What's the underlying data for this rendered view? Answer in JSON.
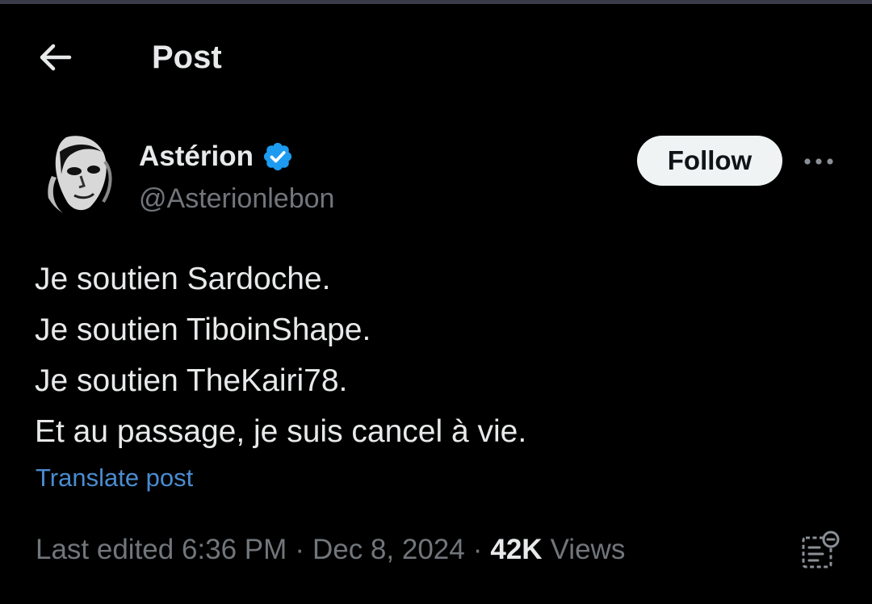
{
  "header": {
    "back_icon": "arrow-left-icon",
    "title": "Post"
  },
  "author": {
    "display_name": "Astérion",
    "handle": "@Asterionlebon",
    "verified_icon": "verified-badge-icon",
    "verified_color": "#1d9bf0"
  },
  "actions": {
    "follow_label": "Follow",
    "more_icon": "more-options-icon"
  },
  "post": {
    "lines": [
      "Je soutien Sardoche.",
      "Je soutien TiboinShape.",
      "Je soutien TheKairi78.",
      "Et au passage, je suis cancel à vie."
    ],
    "translate_label": "Translate post"
  },
  "meta": {
    "edited_time": "Last edited 6:36 PM",
    "separator": "·",
    "date": "Dec 8, 2024",
    "views_count": "42K",
    "views_label": "Views",
    "analytics_icon": "analytics-icon"
  },
  "colors": {
    "background": "#000000",
    "text_primary": "#e7e9ea",
    "text_secondary": "#71767b",
    "link": "#4a8cd0",
    "follow_button_bg": "#eff3f4"
  }
}
